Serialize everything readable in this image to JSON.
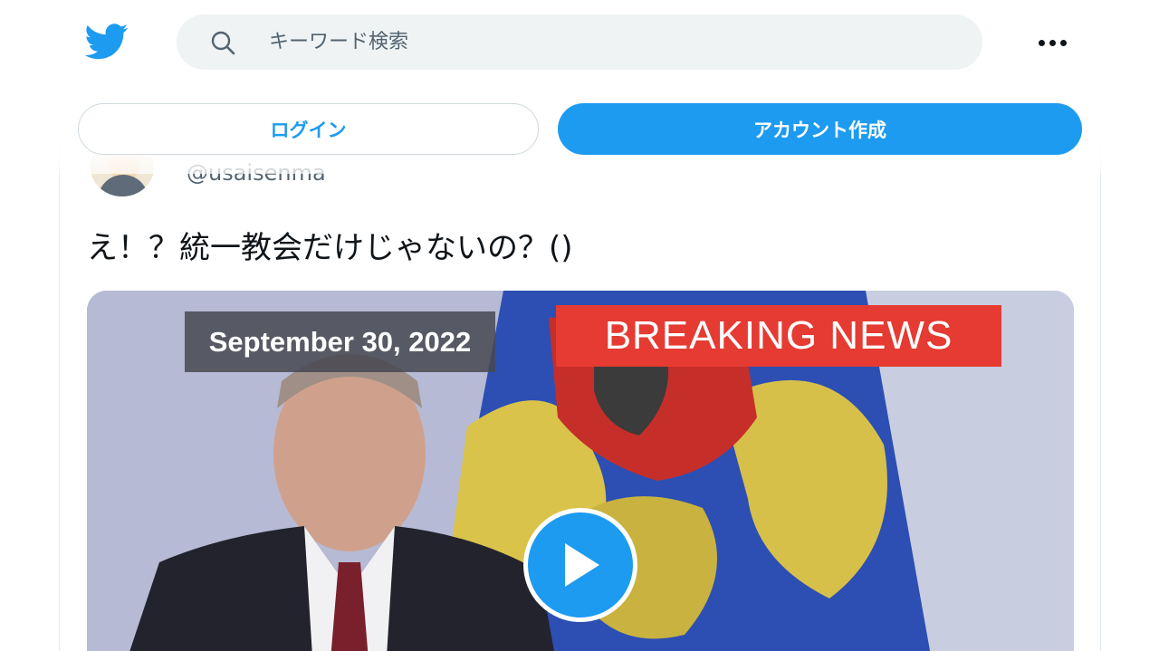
{
  "header": {
    "search_placeholder": "キーワード検索",
    "logo_icon": "twitter-bird-icon",
    "search_icon": "search-icon",
    "more_icon": "more-horizontal-icon"
  },
  "auth": {
    "login_label": "ログイン",
    "signup_label": "アカウント作成"
  },
  "tweet": {
    "handle": "@usaisenma",
    "text": "え！？統一教会だけじゃないの？()",
    "media": {
      "date_caption": "September 30, 2022",
      "breaking_caption": "BREAKING NEWS",
      "play_icon": "play-icon"
    }
  },
  "colors": {
    "accent": "#1d9bf0",
    "breaking_red": "#e53b32",
    "search_bg": "#eff3f4"
  }
}
